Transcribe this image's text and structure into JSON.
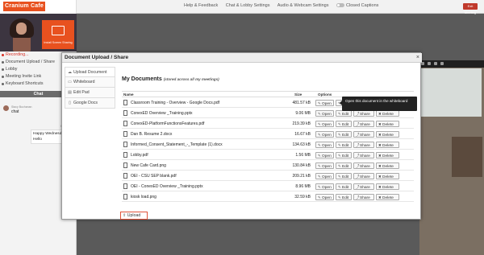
{
  "topbar": {
    "logo": "Cranium Cafe",
    "links": [
      "Help & Feedback",
      "Chat & Lobby Settings",
      "Audio & Webcam Settings"
    ],
    "closed_captions": "Closed Captions",
    "exit": "Exit Meeting"
  },
  "video": {
    "share_label": "Install Screen Sharing"
  },
  "sidebar": {
    "items": [
      {
        "label": "Recording...",
        "icon": "record-icon"
      },
      {
        "label": "Document Upload / Share",
        "icon": "document-icon"
      },
      {
        "label": "Lobby",
        "icon": "lobby-icon"
      },
      {
        "label": "Meeting Invite Link",
        "icon": "link-icon"
      },
      {
        "label": "Keyboard Shortcuts",
        "icon": "keyboard-icon"
      }
    ],
    "chat_title": "Chat",
    "chat": [
      {
        "name": "Stacy Buchanan",
        "text": "chat"
      },
      {
        "name": "Heather Loi",
        "text": "Happy Wednesday!\nHello"
      }
    ]
  },
  "modal": {
    "title": "Document Upload / Share",
    "close": "×",
    "tabs": [
      {
        "label": "Upload Document",
        "icon": "cloud-upload-icon"
      },
      {
        "label": "Whiteboard",
        "icon": "whiteboard-icon"
      },
      {
        "label": "Edit Pad",
        "icon": "edit-pad-icon"
      },
      {
        "label": "Google Docs",
        "icon": "google-docs-icon"
      }
    ],
    "heading": "My Documents",
    "heading_sub": "(stored across all my meetings)",
    "columns": {
      "name": "Name",
      "size": "Size",
      "options": "Options"
    },
    "buttons": {
      "open": "Open",
      "edit": "Edit",
      "share": "Share",
      "delete": "Delete"
    },
    "files": [
      {
        "name": "Classroom Training - Overview - Google Docs.pdf",
        "size": "481.57 kB"
      },
      {
        "name": "ConexED Overview _Training.pptx",
        "size": "9.06 MB"
      },
      {
        "name": "ConexED-PlatformFunctionsFeatures.pdf",
        "size": "219.39 kB"
      },
      {
        "name": "Dan B. Resume 2.docx",
        "size": "16.67 kB"
      },
      {
        "name": "Informed_Consent_Statement_-_Template (1).docx",
        "size": "134.63 kB"
      },
      {
        "name": "Lobby.pdf",
        "size": "1.56 MB"
      },
      {
        "name": "New Cafe Card.png",
        "size": "130.84 kB"
      },
      {
        "name": "OEI - CSU SEP blank.pdf",
        "size": "209.21 kB"
      },
      {
        "name": "OEI - ConexED Overview _Training.pptx",
        "size": "8.96 MB"
      },
      {
        "name": "kiosk load.png",
        "size": "32.59 kB"
      }
    ],
    "upload": "Upload"
  },
  "tooltip": "Open this document in the whiteboard",
  "colors": {
    "brand": "#e8511f",
    "exit": "#c0392b",
    "recording": "#d93025"
  }
}
